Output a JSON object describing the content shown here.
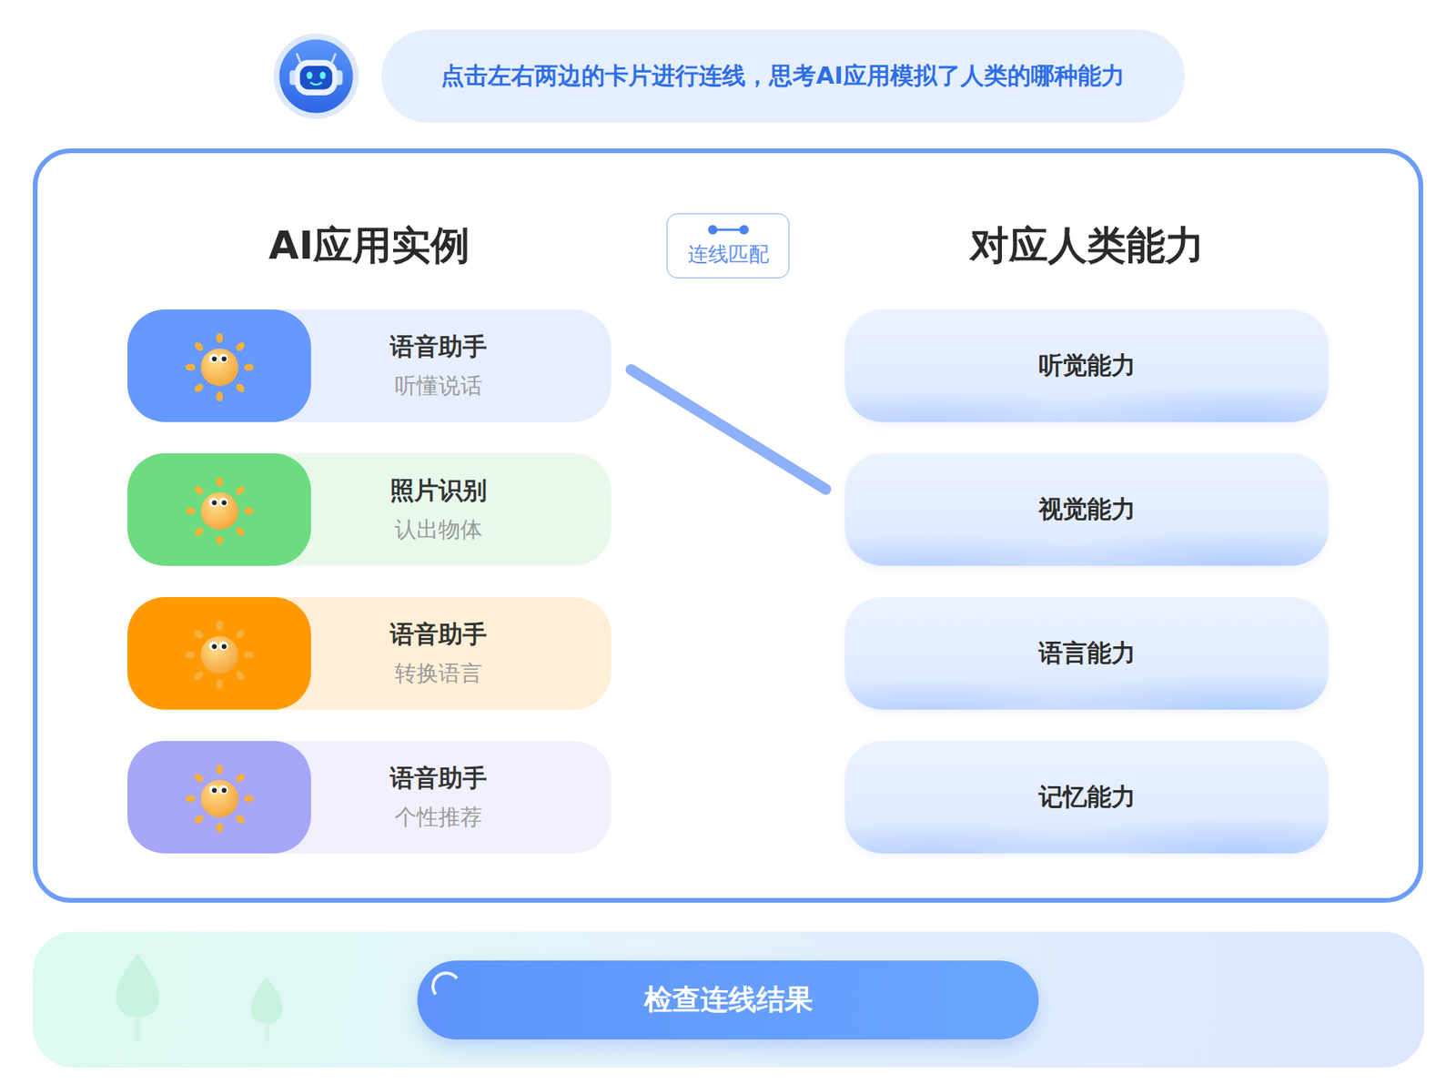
{
  "header": {
    "instruction": "点击左右两边的卡片进行连线，思考AI应用模拟了人类的哪种能力"
  },
  "left": {
    "title": "AI应用实例",
    "items": [
      {
        "title": "语音助手",
        "subtitle": "听懂说话",
        "color": "#6699ff"
      },
      {
        "title": "照片识别",
        "subtitle": "认出物体",
        "color": "#6ddc80"
      },
      {
        "title": "语音助手",
        "subtitle": "转换语言",
        "color": "#ff9a05"
      },
      {
        "title": "语音助手",
        "subtitle": "个性推荐",
        "color": "#a8a6f8"
      }
    ]
  },
  "matchBadge": {
    "label": "连线匹配"
  },
  "right": {
    "title": "对应人类能力",
    "items": [
      {
        "label": "听觉能力"
      },
      {
        "label": "视觉能力"
      },
      {
        "label": "语言能力"
      },
      {
        "label": "记忆能力"
      }
    ]
  },
  "connections": [
    {
      "from": 0,
      "to": 1
    }
  ],
  "checkButton": {
    "label": "检查连线结果"
  }
}
